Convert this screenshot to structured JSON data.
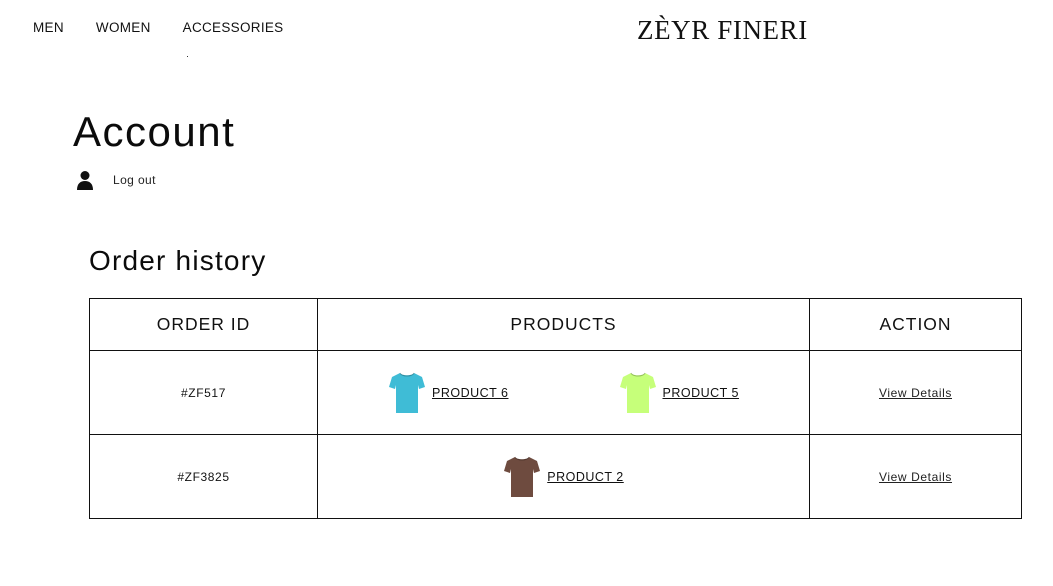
{
  "nav": {
    "items": [
      {
        "label": "MEN"
      },
      {
        "label": "WOMEN"
      },
      {
        "label": "ACCESSORIES"
      }
    ],
    "brand": "ZÈYR FINERI"
  },
  "account": {
    "title": "Account",
    "logout_label": "Log out",
    "user_icon": "user-icon"
  },
  "orders": {
    "title": "Order history",
    "columns": [
      "ORDER ID",
      "PRODUCTS",
      "ACTION"
    ],
    "rows": [
      {
        "order_id": "#ZF517",
        "products": [
          {
            "name": "PRODUCT 6",
            "color": "#3fbcd6"
          },
          {
            "name": "PRODUCT 5",
            "color": "#c6ff7a"
          }
        ],
        "action": "View Details"
      },
      {
        "order_id": "#ZF3825",
        "products": [
          {
            "name": "PRODUCT 2",
            "color": "#6e4b3f"
          }
        ],
        "action": "View Details"
      }
    ]
  }
}
